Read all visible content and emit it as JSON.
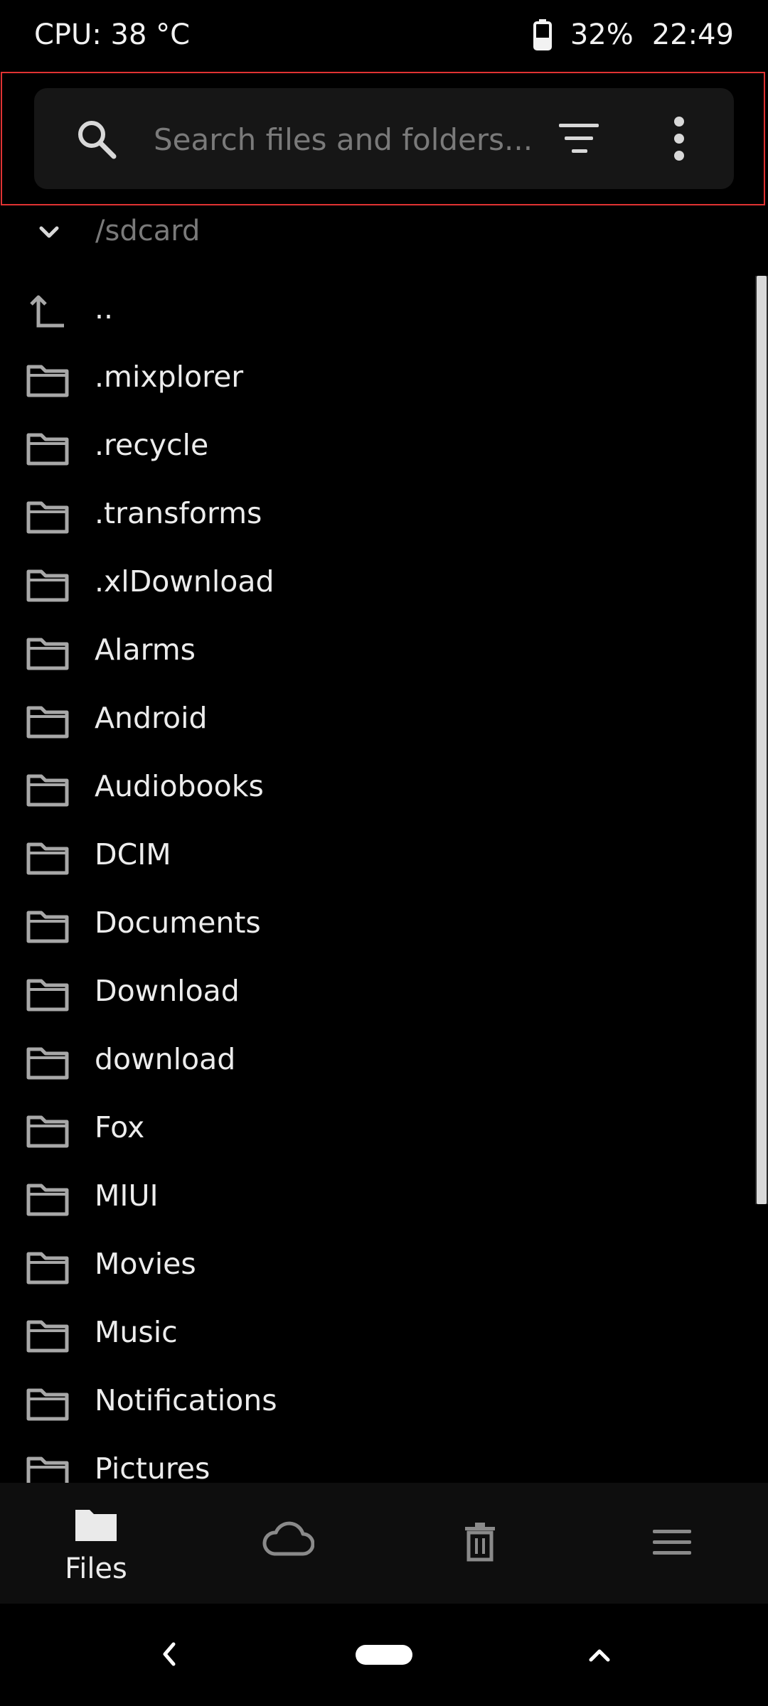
{
  "status_bar": {
    "cpu_temp": "CPU: 38 °C",
    "battery": "32%",
    "time": "22:49"
  },
  "search": {
    "placeholder": "Search files and folders...",
    "icons": [
      "search-icon",
      "sort-filter-icon",
      "more-vert-icon"
    ]
  },
  "path": {
    "label": "/sdcard",
    "icon": "chevron-down-icon"
  },
  "files": [
    {
      "name": "..",
      "icon": "parent-dir-icon"
    },
    {
      "name": ".mixplorer",
      "icon": "folder-icon"
    },
    {
      "name": ".recycle",
      "icon": "folder-icon"
    },
    {
      "name": ".transforms",
      "icon": "folder-icon"
    },
    {
      "name": ".xlDownload",
      "icon": "folder-icon"
    },
    {
      "name": "Alarms",
      "icon": "folder-icon"
    },
    {
      "name": "Android",
      "icon": "folder-icon"
    },
    {
      "name": "Audiobooks",
      "icon": "folder-icon"
    },
    {
      "name": "DCIM",
      "icon": "folder-icon"
    },
    {
      "name": "Documents",
      "icon": "folder-icon"
    },
    {
      "name": "Download",
      "icon": "folder-icon"
    },
    {
      "name": "download",
      "icon": "folder-icon"
    },
    {
      "name": "Fox",
      "icon": "folder-icon"
    },
    {
      "name": "MIUI",
      "icon": "folder-icon"
    },
    {
      "name": "Movies",
      "icon": "folder-icon"
    },
    {
      "name": "Music",
      "icon": "folder-icon"
    },
    {
      "name": "Notifications",
      "icon": "folder-icon"
    },
    {
      "name": "Pictures",
      "icon": "folder-icon"
    }
  ],
  "bottom_nav": {
    "files_label": "Files",
    "items": [
      "files-icon",
      "cloud-icon",
      "trash-icon",
      "menu-icon"
    ]
  },
  "colors": {
    "background": "#000000",
    "text": "#ececec",
    "muted": "#7a7a7a",
    "highlight": "#e03333",
    "icon": "#a8a8a8"
  }
}
